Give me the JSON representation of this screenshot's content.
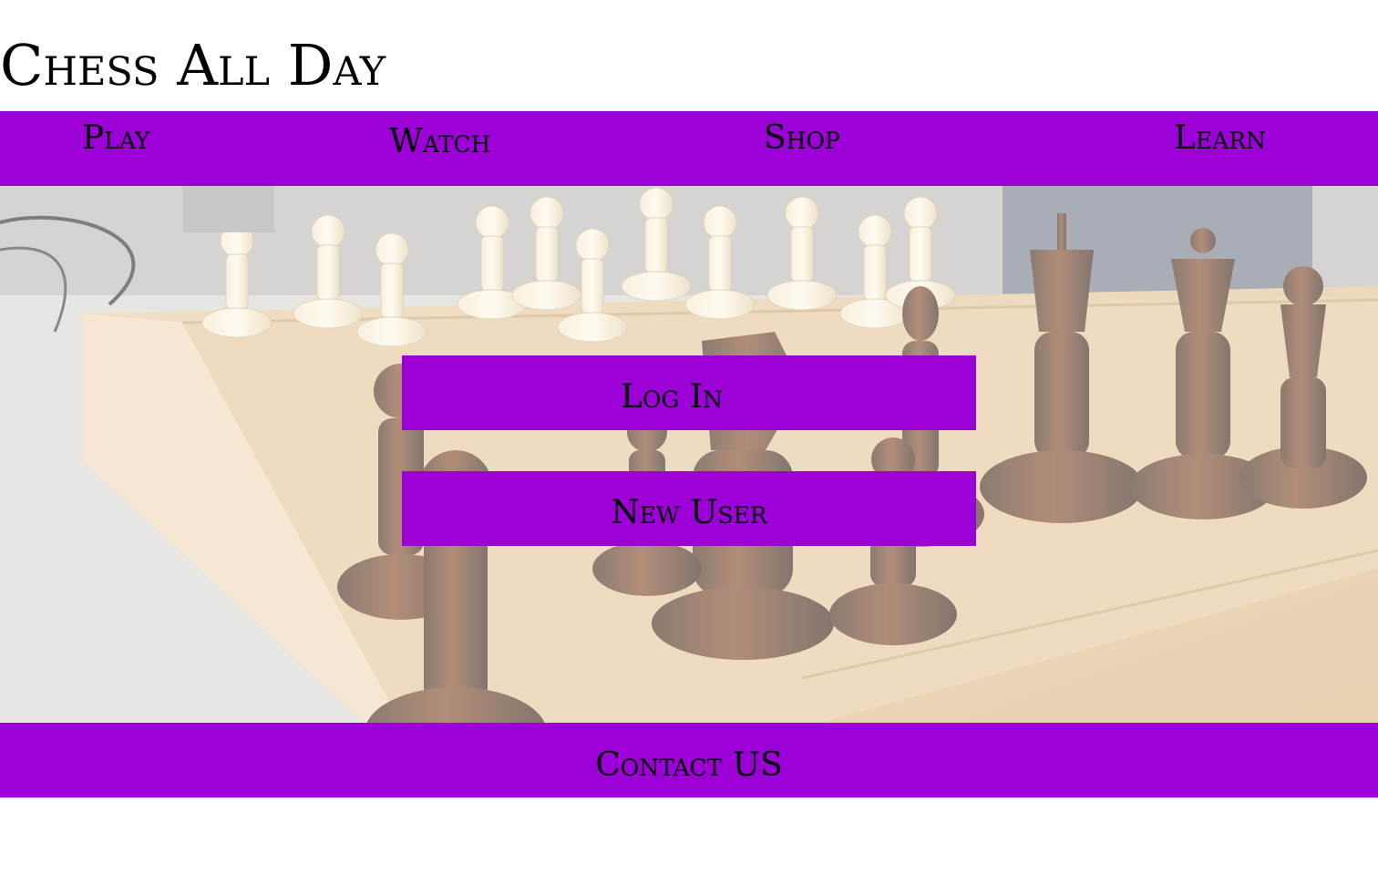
{
  "header": {
    "title": "Chess All Day"
  },
  "nav": {
    "items": [
      {
        "label": "Play"
      },
      {
        "label": "Watch"
      },
      {
        "label": "Shop"
      },
      {
        "label": "Learn"
      }
    ]
  },
  "hero": {
    "background_image": "chess-pieces-photo",
    "login_label": "Log In",
    "new_user_label": "New User"
  },
  "footer": {
    "contact_label": "Contact US"
  },
  "colors": {
    "accent": "#9b00d6",
    "text": "#000000",
    "background": "#ffffff"
  }
}
